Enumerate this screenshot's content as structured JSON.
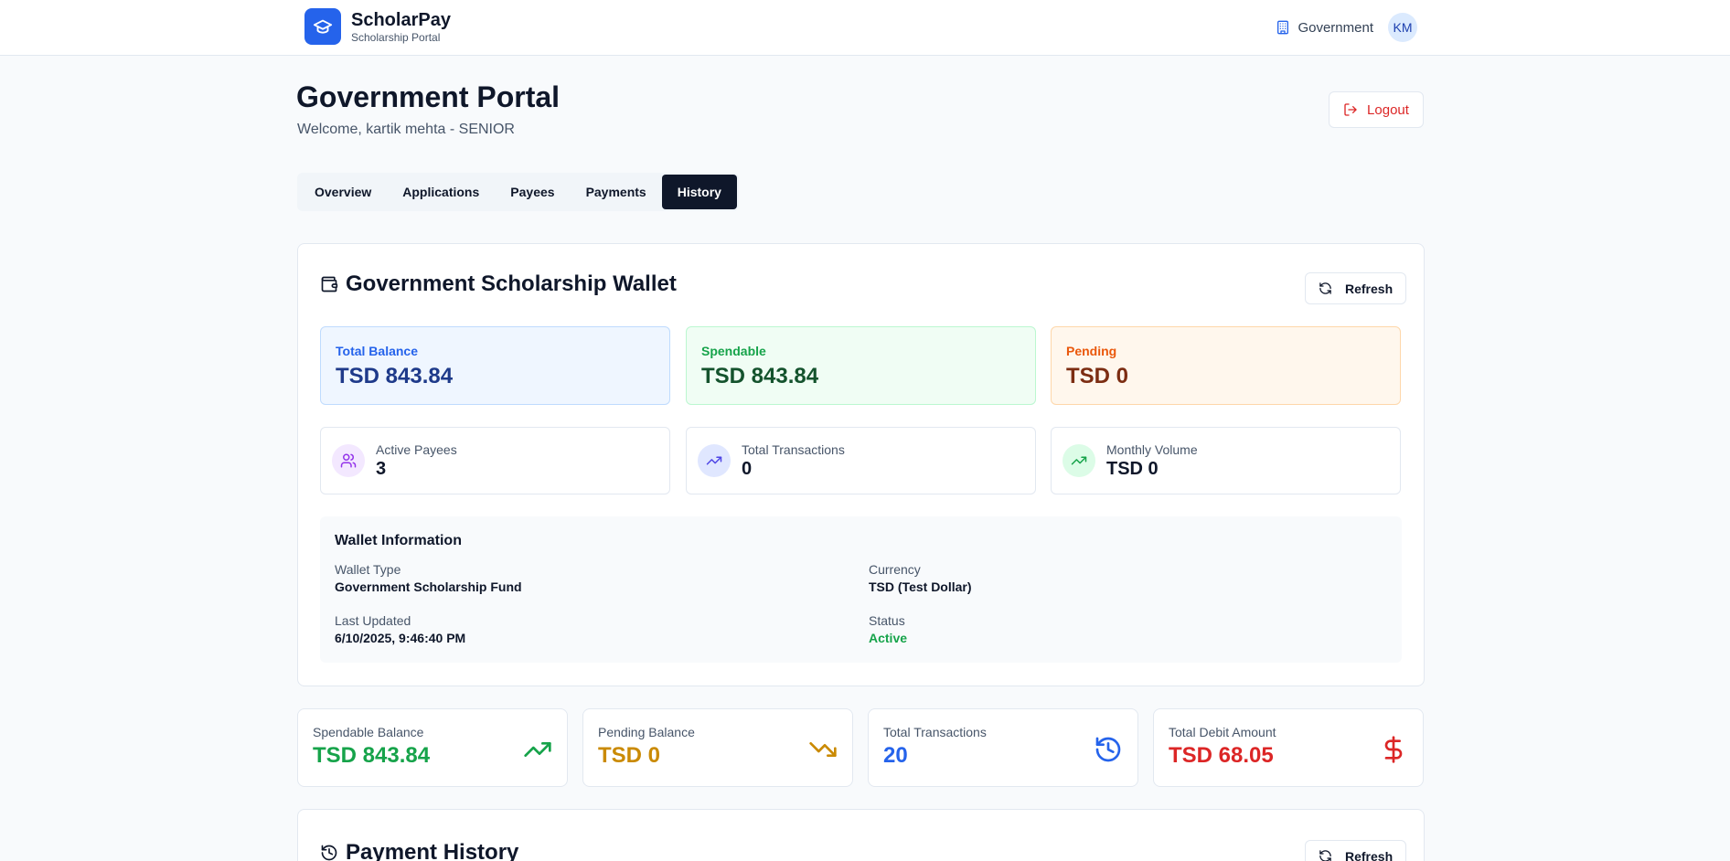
{
  "brand": {
    "name": "ScholarPay",
    "subtitle": "Scholarship Portal"
  },
  "nav": {
    "role": "Government",
    "avatar_initials": "KM"
  },
  "header": {
    "title": "Government Portal",
    "welcome": "Welcome, kartik mehta - SENIOR",
    "logout_label": "Logout"
  },
  "tabs": [
    {
      "label": "Overview",
      "active": false
    },
    {
      "label": "Applications",
      "active": false
    },
    {
      "label": "Payees",
      "active": false
    },
    {
      "label": "Payments",
      "active": false
    },
    {
      "label": "History",
      "active": true
    }
  ],
  "wallet": {
    "title": "Government Scholarship Wallet",
    "refresh_label": "Refresh",
    "balances": [
      {
        "label": "Total Balance",
        "value": "TSD 843.84"
      },
      {
        "label": "Spendable",
        "value": "TSD 843.84"
      },
      {
        "label": "Pending",
        "value": "TSD 0"
      }
    ],
    "stats": [
      {
        "label": "Active Payees",
        "value": "3",
        "icon": "users-icon"
      },
      {
        "label": "Total Transactions",
        "value": "0",
        "icon": "trending-up-icon"
      },
      {
        "label": "Monthly Volume",
        "value": "TSD 0",
        "icon": "trending-up-icon"
      }
    ],
    "info": {
      "title": "Wallet Information",
      "wallet_type_label": "Wallet Type",
      "wallet_type": "Government Scholarship Fund",
      "currency_label": "Currency",
      "currency": "TSD (Test Dollar)",
      "last_updated_label": "Last Updated",
      "last_updated": "6/10/2025, 9:46:40 PM",
      "status_label": "Status",
      "status": "Active"
    }
  },
  "summary": [
    {
      "label": "Spendable Balance",
      "value": "TSD 843.84",
      "color": "#16a34a",
      "icon": "trending-up-icon"
    },
    {
      "label": "Pending Balance",
      "value": "TSD 0",
      "color": "#ca8a04",
      "icon": "trending-down-icon"
    },
    {
      "label": "Total Transactions",
      "value": "20",
      "color": "#2563eb",
      "icon": "history-icon"
    },
    {
      "label": "Total Debit Amount",
      "value": "TSD 68.05",
      "color": "#dc2626",
      "icon": "dollar-icon"
    }
  ],
  "history": {
    "title": "Payment History",
    "refresh_label": "Refresh"
  },
  "colors": {
    "primary": "#2563eb",
    "dark": "#0f172a",
    "danger": "#dc2626",
    "success": "#16a34a"
  }
}
